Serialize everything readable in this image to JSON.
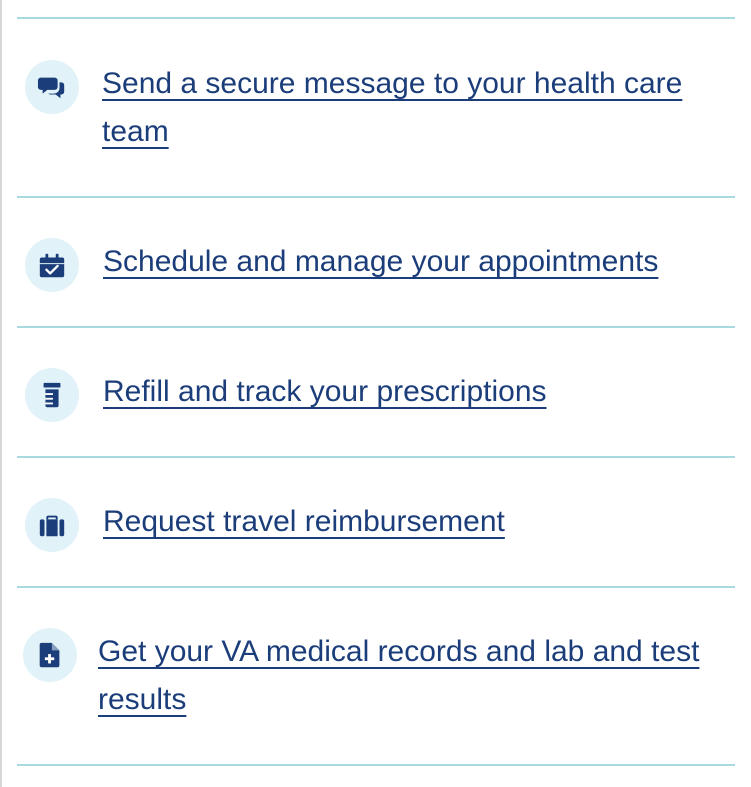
{
  "colors": {
    "link": "#1b3d7a",
    "icon": "#1b3d7a",
    "icon_background": "#e1f3f8",
    "divider": "#a8d8e0"
  },
  "links": [
    {
      "label": "Send a secure message to your health care team",
      "icon": "comments-icon"
    },
    {
      "label": "Schedule and manage your appointments",
      "icon": "calendar-check-icon"
    },
    {
      "label": "Refill and track your prescriptions",
      "icon": "prescription-bottle-icon"
    },
    {
      "label": "Request travel reimbursement",
      "icon": "suitcase-icon"
    },
    {
      "label": "Get your VA medical records and lab and test results",
      "icon": "file-medical-icon"
    }
  ]
}
